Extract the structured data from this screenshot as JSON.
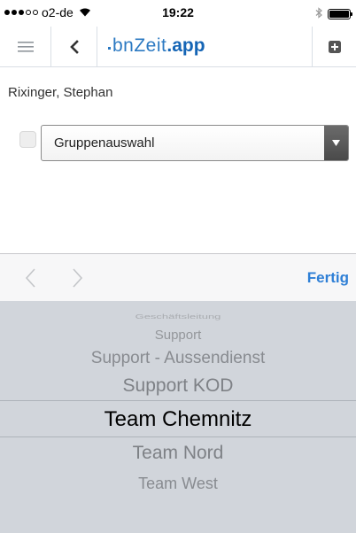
{
  "status_bar": {
    "carrier": "o2-de",
    "time": "19:22",
    "signal_dots_filled": 3,
    "signal_dots_total": 5
  },
  "header": {
    "brand_light": "bnZeit",
    "brand_bold": ".app",
    "icons": [
      "hamburger-menu-icon",
      "chevron-left-icon",
      "plus-square-icon"
    ],
    "brand_color": "#2b79c2"
  },
  "main": {
    "user_name": "Rixinger, Stephan",
    "group_checked": false,
    "group_select_value": "Gruppenauswahl"
  },
  "picker": {
    "toolbar": {
      "done_label": "Fertig",
      "done_color": "#2e7fd6"
    },
    "items": [
      "Geschäftsleitung",
      "Support",
      "Support - Aussendienst",
      "Support KOD",
      "Team Chemnitz",
      "Team Nord",
      "Team West"
    ],
    "selected": "Team Chemnitz"
  }
}
